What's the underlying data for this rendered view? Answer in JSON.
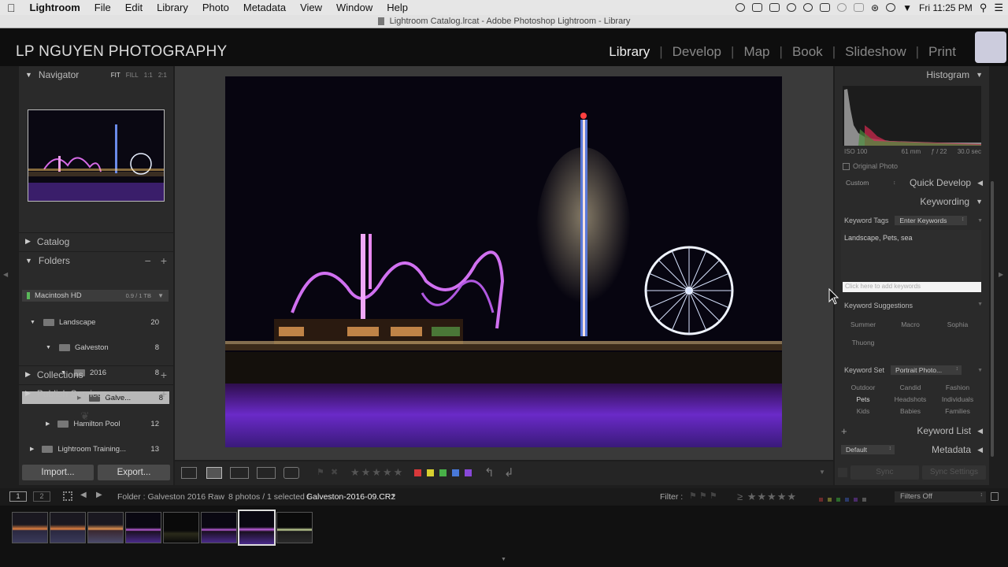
{
  "menubar": {
    "items": [
      "Lightroom",
      "File",
      "Edit",
      "Library",
      "Photo",
      "Metadata",
      "View",
      "Window",
      "Help"
    ],
    "clock": "Fri 11:25 PM"
  },
  "window": {
    "title": "Lightroom Catalog.lrcat - Adobe Photoshop Lightroom - Library"
  },
  "identity": {
    "brand": "LP NGUYEN PHOTOGRAPHY"
  },
  "modules": [
    "Library",
    "Develop",
    "Map",
    "Book",
    "Slideshow",
    "Print"
  ],
  "navigator": {
    "title": "Navigator",
    "zoom": [
      "FIT",
      "FILL",
      "1:1",
      "2:1"
    ]
  },
  "catalog": {
    "title": "Catalog"
  },
  "folders": {
    "title": "Folders",
    "volume": {
      "name": "Macintosh HD",
      "size": "0.9 / 1 TB"
    },
    "rows": [
      {
        "name": "Landscape",
        "count": "20"
      },
      {
        "name": "Galveston",
        "count": "8"
      },
      {
        "name": "2016",
        "count": "8"
      },
      {
        "name": "Galve...",
        "count": "8"
      },
      {
        "name": "Hamilton Pool",
        "count": "12"
      },
      {
        "name": "Lightroom Training...",
        "count": "13"
      }
    ]
  },
  "collections": {
    "title": "Collections"
  },
  "publish": {
    "title": "Publish Services"
  },
  "buttons": {
    "import": "Import...",
    "export": "Export..."
  },
  "histogram": {
    "title": "Histogram",
    "iso": "ISO 100",
    "focal": "61 mm",
    "aperture": "ƒ / 22",
    "shutter": "30.0 sec",
    "original": "Original Photo"
  },
  "quickdevelop": {
    "title": "Quick Develop",
    "preset": "Custom"
  },
  "keywording": {
    "title": "Keywording",
    "tags_label": "Keyword Tags",
    "tags_mode": "Enter Keywords",
    "tags_value": "Landscape, Pets, sea",
    "add_placeholder": "Click here to add keywords",
    "suggestions_label": "Keyword Suggestions",
    "suggestions": [
      "Summer",
      "Macro",
      "Sophia",
      "Thuong"
    ],
    "set_label": "Keyword Set",
    "set_value": "Portrait Photo...",
    "set_items": [
      "Outdoor",
      "Candid",
      "Fashion",
      "Pets",
      "Headshots",
      "Individuals",
      "Kids",
      "Babies",
      "Families"
    ]
  },
  "keywordlist": {
    "title": "Keyword List"
  },
  "metadata": {
    "title": "Metadata",
    "preset": "Default"
  },
  "sync": {
    "sync": "Sync",
    "settings": "Sync Settings"
  },
  "filmhdr": {
    "screens": [
      "1",
      "2"
    ],
    "source": "Folder : Galveston 2016 Raw",
    "count": "8 photos / 1 selected /",
    "file": "Galveston-2016-09.CR2",
    "filter_label": "Filter :",
    "filter_value": "Filters Off"
  },
  "colors": {
    "label_red": "#d8383a",
    "label_yellow": "#d8d030",
    "label_green": "#48b048",
    "label_blue": "#4878d8",
    "label_purple": "#8848d8"
  }
}
